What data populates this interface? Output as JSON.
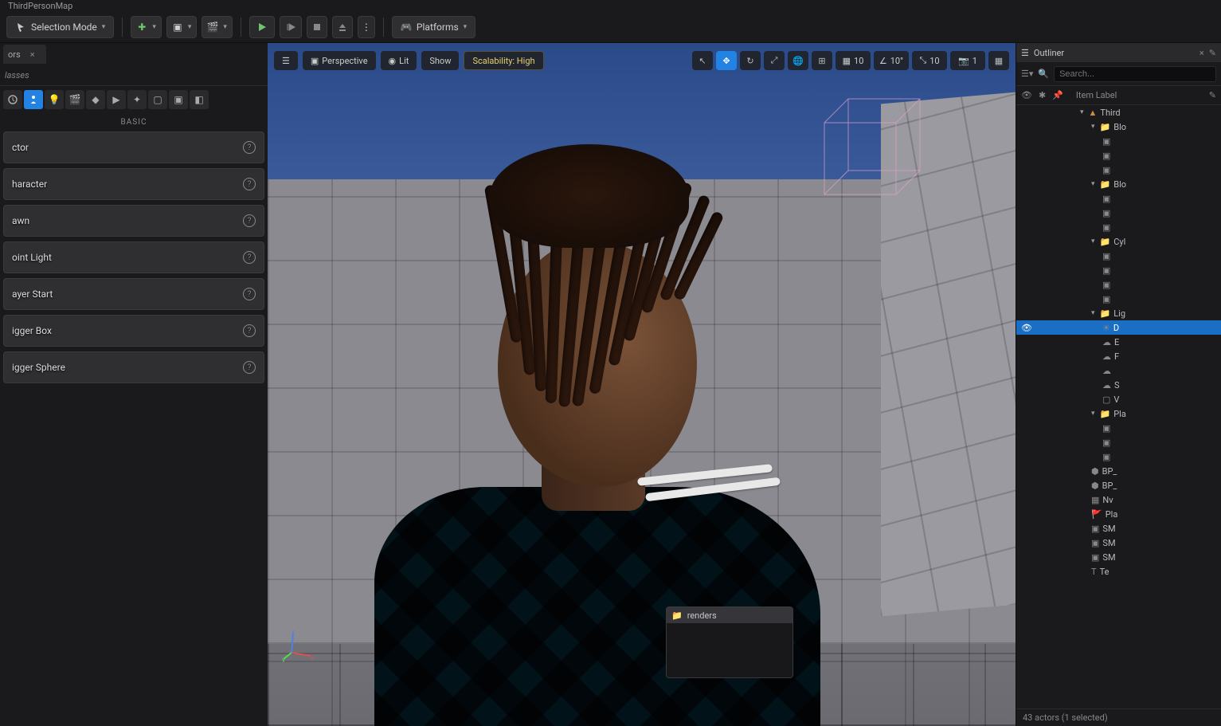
{
  "level_name": "ThirdPersonMap",
  "toolbar": {
    "mode_label": "Selection Mode",
    "platforms_label": "Platforms"
  },
  "place_actors": {
    "tab_label": "ors",
    "search_placeholder": "lasses",
    "section": "BASIC",
    "items": [
      {
        "label": "ctor"
      },
      {
        "label": "haracter"
      },
      {
        "label": "awn"
      },
      {
        "label": "oint Light"
      },
      {
        "label": "ayer Start"
      },
      {
        "label": "igger Box"
      },
      {
        "label": "igger Sphere"
      }
    ]
  },
  "viewport": {
    "perspective": "Perspective",
    "lit": "Lit",
    "show": "Show",
    "scalability": "Scalability: High",
    "snap_grid": "10",
    "snap_angle": "10°",
    "snap_scale": "10",
    "camera_speed": "1"
  },
  "folder_popup": {
    "name": "renders"
  },
  "outliner": {
    "tab_label": "Outliner",
    "search_placeholder": "Search...",
    "header": "Item Label",
    "status": "43 actors (1 selected)",
    "tree": [
      {
        "k": "world",
        "label": "Third",
        "depth": 0,
        "type": "world",
        "expanded": true
      },
      {
        "k": "block1",
        "label": "Blo",
        "depth": 1,
        "type": "folder",
        "expanded": true
      },
      {
        "k": "a1",
        "label": "",
        "depth": 2,
        "type": "sm"
      },
      {
        "k": "a2",
        "label": "",
        "depth": 2,
        "type": "sm"
      },
      {
        "k": "a3",
        "label": "",
        "depth": 2,
        "type": "sm"
      },
      {
        "k": "block2",
        "label": "Blo",
        "depth": 1,
        "type": "folder",
        "expanded": true
      },
      {
        "k": "b1",
        "label": "",
        "depth": 2,
        "type": "sm"
      },
      {
        "k": "b2",
        "label": "",
        "depth": 2,
        "type": "sm"
      },
      {
        "k": "b3",
        "label": "",
        "depth": 2,
        "type": "sm"
      },
      {
        "k": "cyl",
        "label": "Cyl",
        "depth": 1,
        "type": "folder",
        "expanded": true
      },
      {
        "k": "c1",
        "label": "",
        "depth": 2,
        "type": "sm"
      },
      {
        "k": "c2",
        "label": "",
        "depth": 2,
        "type": "sm"
      },
      {
        "k": "c3",
        "label": "",
        "depth": 2,
        "type": "sm"
      },
      {
        "k": "c4",
        "label": "",
        "depth": 2,
        "type": "sm"
      },
      {
        "k": "light",
        "label": "Lig",
        "depth": 1,
        "type": "folder",
        "expanded": true
      },
      {
        "k": "dl",
        "label": "D",
        "depth": 2,
        "type": "light",
        "selected": true
      },
      {
        "k": "eh",
        "label": "E",
        "depth": 2,
        "type": "fog"
      },
      {
        "k": "fog",
        "label": "F",
        "depth": 2,
        "type": "fog"
      },
      {
        "k": "sky",
        "label": "",
        "depth": 2,
        "type": "sky"
      },
      {
        "k": "sl",
        "label": "S",
        "depth": 2,
        "type": "sky"
      },
      {
        "k": "vc",
        "label": "V",
        "depth": 2,
        "type": "vol"
      },
      {
        "k": "play",
        "label": "Pla",
        "depth": 1,
        "type": "folder",
        "expanded": true
      },
      {
        "k": "p1",
        "label": "",
        "depth": 2,
        "type": "sm"
      },
      {
        "k": "p2",
        "label": "",
        "depth": 2,
        "type": "sm"
      },
      {
        "k": "p3",
        "label": "",
        "depth": 2,
        "type": "sm"
      },
      {
        "k": "bp1",
        "label": "BP_",
        "depth": 1,
        "type": "bp"
      },
      {
        "k": "bp2",
        "label": "BP_",
        "depth": 1,
        "type": "bp"
      },
      {
        "k": "nv",
        "label": "Nv",
        "depth": 1,
        "type": "nav"
      },
      {
        "k": "ps",
        "label": "Pla",
        "depth": 1,
        "type": "player"
      },
      {
        "k": "sm1",
        "label": "SM",
        "depth": 1,
        "type": "sm"
      },
      {
        "k": "sm2",
        "label": "SM",
        "depth": 1,
        "type": "sm"
      },
      {
        "k": "sm3",
        "label": "SM",
        "depth": 1,
        "type": "sm"
      },
      {
        "k": "tex",
        "label": "Te",
        "depth": 1,
        "type": "tex"
      }
    ]
  }
}
